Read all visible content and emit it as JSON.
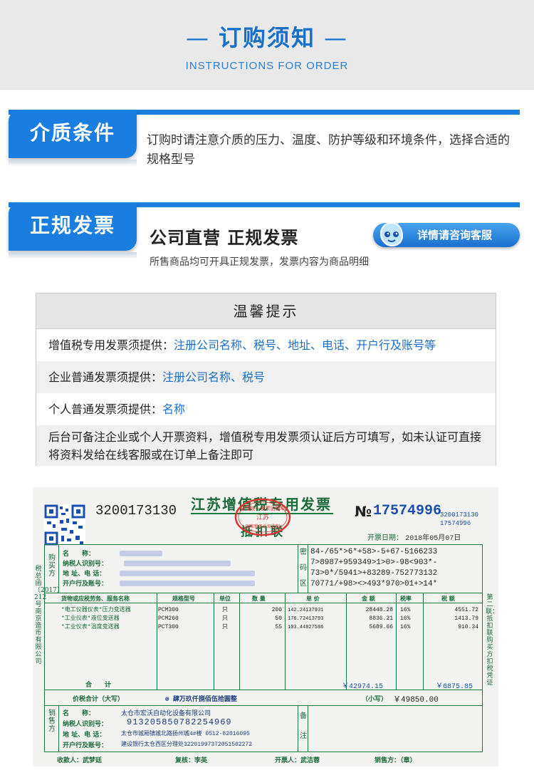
{
  "header": {
    "title": "订购须知",
    "subtitle": "INSTRUCTIONS FOR ORDER"
  },
  "section_medium": {
    "tab": "介质条件",
    "text": "订购时请注意介质的压力、温度、防护等级和环境条件，选择合适的规格型号"
  },
  "section_invoice": {
    "tab": "正规发票",
    "title": "公司直营  正规发票",
    "subtitle": "所售商品均可开具正规发票，发票内容为商品明细",
    "consult_button": "详情请咨询客服"
  },
  "notice": {
    "title": "温馨提示",
    "rows": [
      {
        "label": "增值税专用发票须提供：",
        "value": "注册公司名称、税号、地址、电话、开户行及账号等"
      },
      {
        "label": "企业普通发票须提供：",
        "value": "注册公司名称、税号"
      },
      {
        "label": "个人普通发票须提供：",
        "value": "名称"
      },
      {
        "label": "后台可备注企业或个人开票资料，增值税专用发票须认证后方可填写，如未认证可直接将资料发给在线客服或在订单上备注即可",
        "value": ""
      }
    ]
  },
  "invoice": {
    "code": "3200173130",
    "title": "江苏增值税专用发票",
    "copy_label": "抵扣联",
    "no_mark": "№",
    "number": "17574996",
    "code_small": "3200173130",
    "number_small": "17574996",
    "date_label": "开票日期：",
    "date": "2018年05月07日",
    "buyer_side": "购买方",
    "buyer_labels": [
      "名　　称：",
      "纳税人识别号：",
      "地 址、电 话：",
      "开户行及账号："
    ],
    "password_side": [
      "密",
      "码",
      "区"
    ],
    "password_lines": [
      "84-/65*>6*+58>-5+67-5166233",
      "7>8987+959349>1>0>-98<903*-",
      "73>0*/5941>+83289-752773132",
      "70771/+98><>493*970>01+>14*"
    ],
    "columns": [
      "货物或应税劳务、服务名称",
      "规格型号",
      "单位",
      "数 量",
      "单 价",
      "金 额",
      "税率",
      "税 额"
    ],
    "items": [
      {
        "name": "*电工仪器仪表*压力变送器",
        "model": "PCM300",
        "unit": "只",
        "qty": "200",
        "price": "142.24137931",
        "amount": "28448.28",
        "rate": "16%",
        "tax": "4551.72"
      },
      {
        "name": "*工业仪表*液位变送器",
        "model": "PCM260",
        "unit": "只",
        "qty": "50",
        "price": "176.72413793",
        "amount": "8836.21",
        "rate": "16%",
        "tax": "1413.79"
      },
      {
        "name": "*工业仪表*温度变送器",
        "model": "PCT300",
        "unit": "只",
        "qty": "55",
        "price": "103.44827586",
        "amount": "5689.66",
        "rate": "16%",
        "tax": "910.34"
      }
    ],
    "total_label": "合　　计",
    "total_amount": "￥42974.15",
    "total_tax": "￥6875.85",
    "grand_label": "价税合计（大写）",
    "grand_upper": "⊗ 肆万玖仟捌佰伍拾圆整",
    "grand_small_label": "（小写）",
    "grand_small": "￥49850.00",
    "seller_side": "销售方",
    "seller_labels": [
      "名　　称：",
      "纳税人识别号：",
      "地 址、电 话：",
      "开户行及账号："
    ],
    "seller_name": "太仓市宏沃自动化设备有限公司",
    "seller_tax_id": "913205850782254969",
    "seller_address": "太仓市城厢镇城北路扬州城4#楼 0512-82016095",
    "seller_bank": "建设银行太仓西区分理处32201997372051502272",
    "remark_side": [
      "备",
      "注"
    ],
    "payee_label": "收款人：武梦廷",
    "reviewer_label": "复核：李英",
    "drawer_label": "开票人：武洁蓉",
    "seller_stamp_label": "销售方：（章）",
    "left_side_text": "税总函〔2017〕212号南京造币有限公司",
    "right_side_text": "第二联：抵扣联 购买方扣税凭证",
    "stamp_ring": "全国统一发票监制章",
    "stamp_center": "江苏",
    "stamp_bottom": "国家税务总局监制"
  },
  "colors": {
    "brand_blue": "#1a7de0",
    "highlight_blue": "#1a6fc9",
    "invoice_green": "#1a7a3a",
    "stamp_red": "#d9362f"
  }
}
